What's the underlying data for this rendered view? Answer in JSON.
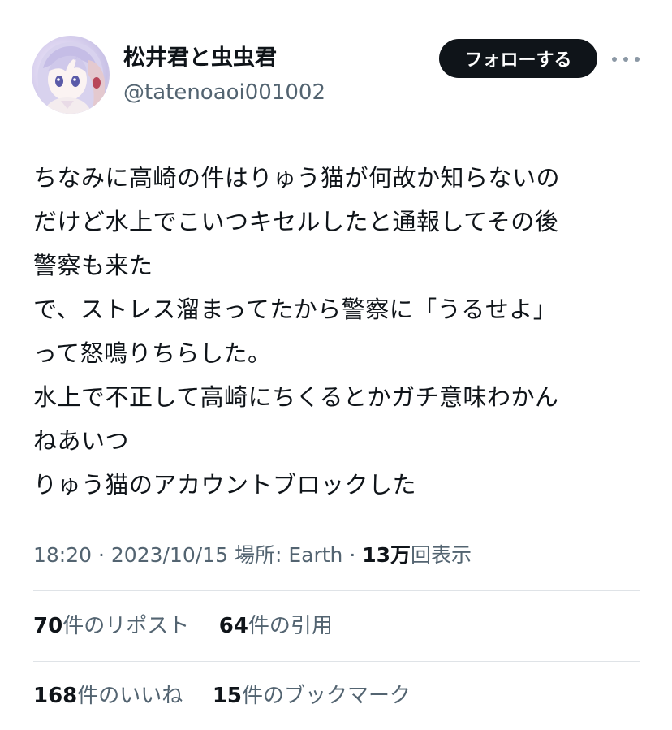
{
  "author": {
    "display_name": "松井君と虫虫君",
    "handle": "@tatenoaoi001002",
    "avatar_icon": "anime-avatar-icon"
  },
  "actions": {
    "follow_label": "フォローする",
    "more_icon": "more-dots-icon"
  },
  "tweet": {
    "lines": [
      "ちなみに高崎の件はりゅう猫が何故か知らないの",
      "だけど水上でこいつキセルしたと通報してその後",
      "警察も来た",
      "で、ストレス溜まってたから警察に「うるせよ」",
      "って怒鳴りちらした。",
      "水上で不正して高崎にちくるとかガチ意味わかん",
      "ねあいつ",
      "りゅう猫のアカウントブロックした"
    ]
  },
  "meta": {
    "time": "18:20",
    "separator": "·",
    "date": "2023/10/15",
    "location": "場所: Earth",
    "views_count": "13万",
    "views_label": "回表示"
  },
  "stats": {
    "reposts_count": "70",
    "reposts_label": "件のリポスト",
    "quotes_count": "64",
    "quotes_label": "件の引用",
    "likes_count": "168",
    "likes_label": "件のいいね",
    "bookmarks_count": "15",
    "bookmarks_label": "件のブックマーク"
  },
  "colors": {
    "text_primary": "#0f1419",
    "text_secondary": "#536471",
    "follow_button_bg": "#0f1419",
    "divider": "#dfe3e7"
  }
}
